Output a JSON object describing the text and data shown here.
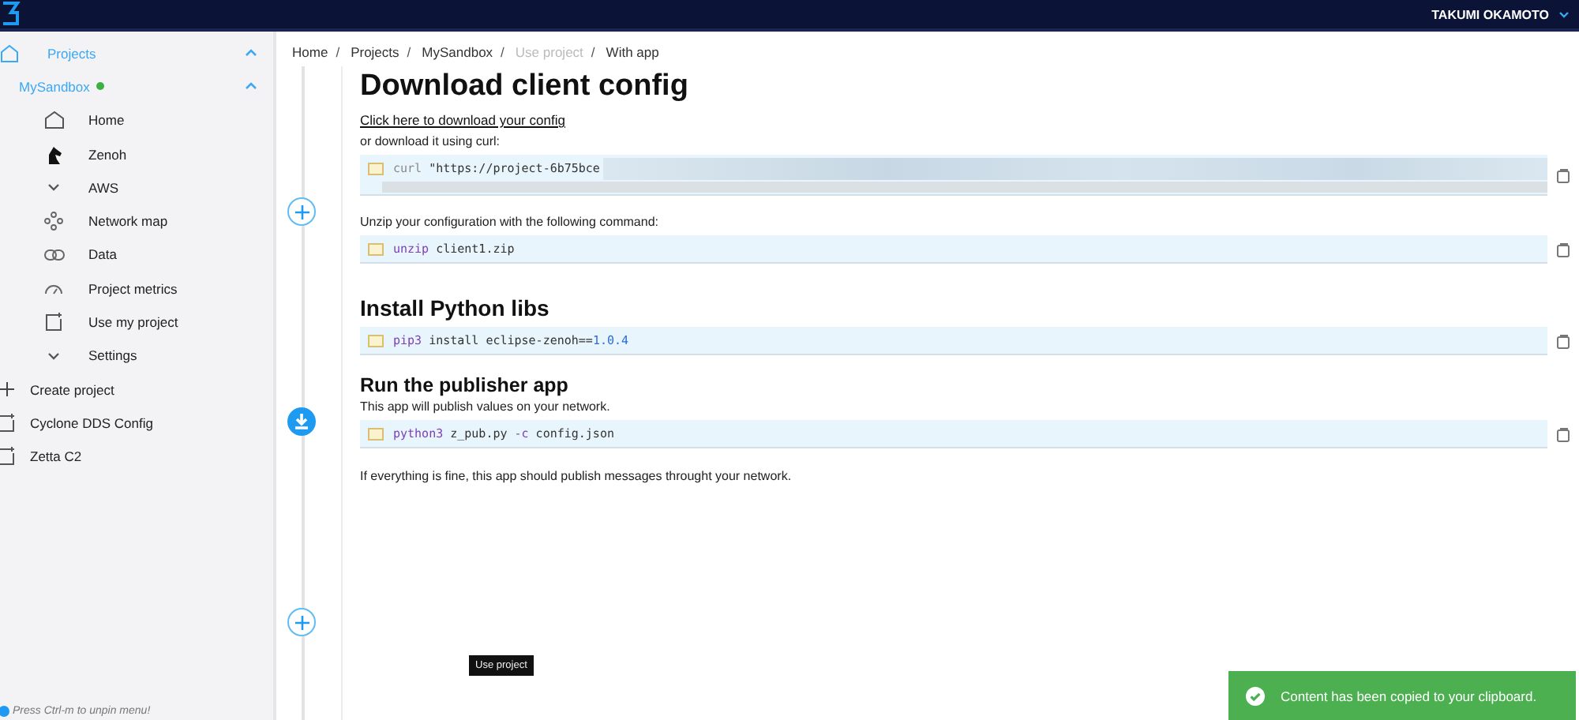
{
  "header": {
    "user_name": "TAKUMI OKAMOTO"
  },
  "sidebar": {
    "projects_label": "Projects",
    "project": {
      "name": "MySandbox"
    },
    "project_items": [
      {
        "label": "Home",
        "kind": "home"
      },
      {
        "label": "Zenoh",
        "kind": "horse"
      },
      {
        "label": "AWS",
        "kind": "group"
      },
      {
        "label": "Network map",
        "kind": "network"
      },
      {
        "label": "Data",
        "kind": "data"
      },
      {
        "label": "Project metrics",
        "kind": "metrics"
      },
      {
        "label": "Use my project",
        "kind": "page"
      },
      {
        "label": "Settings",
        "kind": "group"
      }
    ],
    "items": [
      {
        "label": "Create project",
        "kind": "create"
      },
      {
        "label": "Cyclone DDS Config",
        "kind": "page"
      },
      {
        "label": "Zetta C2",
        "kind": "page"
      }
    ],
    "hint": "Press Ctrl-m to unpin menu!"
  },
  "breadcrumb": [
    {
      "label": "Home",
      "disabled": false,
      "separator": "/"
    },
    {
      "label": "Projects",
      "disabled": false,
      "separator": "/"
    },
    {
      "label": "MySandbox",
      "disabled": false,
      "separator": "/"
    },
    {
      "label": "Use project",
      "disabled": true,
      "separator": "/"
    },
    {
      "label": "With app",
      "disabled": false
    }
  ],
  "timeline": [
    {
      "kind": "plus"
    },
    {
      "kind": "download"
    },
    {
      "kind": "plus"
    }
  ],
  "content": {
    "title": "Download client config",
    "download_link": "Click here to download your config",
    "curl_intro": "or download it using curl:",
    "curl_code": [
      {
        "text": "curl",
        "kind": "builtin"
      },
      {
        "text": " \"https://project-6b75bce",
        "kind": "plain"
      }
    ],
    "unzip_intro": "Unzip your configuration with the following command:",
    "unzip_code": [
      {
        "text": "unzip",
        "kind": "command"
      },
      {
        "text": " client1.zip",
        "kind": "plain"
      }
    ],
    "python_title": "Install Python libs",
    "pip_code": [
      {
        "text": "pip3",
        "kind": "command"
      },
      {
        "text": " install eclipse-zenoh==",
        "kind": "plain"
      },
      {
        "text": "1.0.4",
        "kind": "number"
      }
    ],
    "publisher_title": "Run the publisher app",
    "publisher_intro": "This app will publish values on your network.",
    "python_code": [
      {
        "text": "python3",
        "kind": "command"
      },
      {
        "text": " z_pub.py ",
        "kind": "plain"
      },
      {
        "text": "-c",
        "kind": "command"
      },
      {
        "text": " config.json",
        "kind": "plain"
      }
    ],
    "outro": "If everything is fine, this app should publish messages throught your network."
  },
  "tooltip": "Use project",
  "toast": {
    "message": "Content has been copied to your clipboard."
  }
}
